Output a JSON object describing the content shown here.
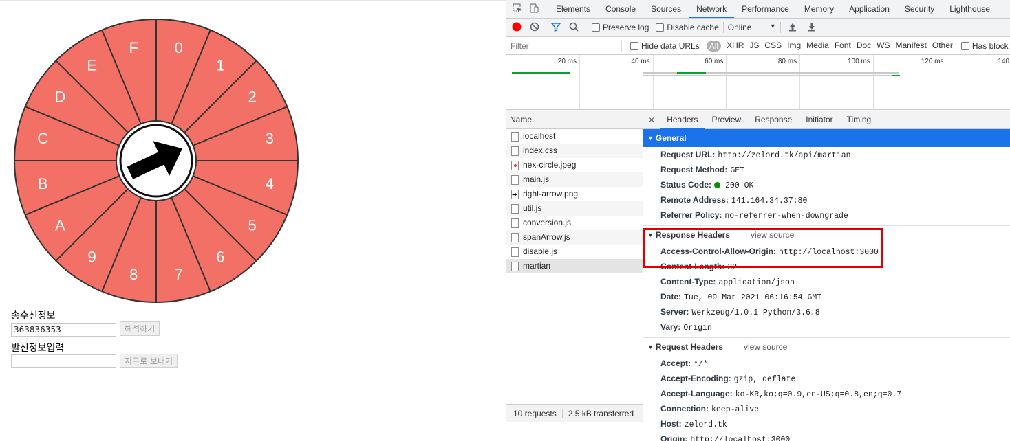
{
  "wheel": {
    "segments": [
      "0",
      "1",
      "2",
      "3",
      "4",
      "5",
      "6",
      "7",
      "8",
      "9",
      "A",
      "B",
      "C",
      "D",
      "E",
      "F"
    ],
    "fill_color": "#f27066",
    "arrow_direction": "3"
  },
  "form": {
    "received_label": "송수신정보",
    "received_value": "363836353",
    "decode_button": "해석하기",
    "send_label": "발신정보입력",
    "send_value": "",
    "send_button": "지구로 보내기"
  },
  "devtools": {
    "tabs": [
      "Elements",
      "Console",
      "Sources",
      "Network",
      "Performance",
      "Memory",
      "Application",
      "Security",
      "Lighthouse"
    ],
    "active_tab": "Network",
    "toolbar": {
      "preserve_log": "Preserve log",
      "disable_cache": "Disable cache",
      "throttle": "Online"
    },
    "filter": {
      "placeholder": "Filter",
      "hide_data_urls": "Hide data URLs",
      "types": [
        "All",
        "XHR",
        "JS",
        "CSS",
        "Img",
        "Media",
        "Font",
        "Doc",
        "WS",
        "Manifest",
        "Other"
      ],
      "has_blocked": "Has block"
    },
    "timeline": [
      "20 ms",
      "40 ms",
      "60 ms",
      "80 ms",
      "100 ms",
      "120 ms",
      "140 m"
    ],
    "name_header": "Name",
    "files": [
      "localhost",
      "index.css",
      "hex-circle.jpeg",
      "main.js",
      "right-arrow.png",
      "util.js",
      "conversion.js",
      "spanArrow.js",
      "disable.js",
      "martian"
    ],
    "selected_file": "martian",
    "status": {
      "requests": "10 requests",
      "transferred": "2.5 kB transferred"
    },
    "detail_tabs": [
      "Headers",
      "Preview",
      "Response",
      "Initiator",
      "Timing"
    ],
    "active_detail_tab": "Headers",
    "general": {
      "title": "General",
      "rows": [
        {
          "k": "Request URL:",
          "v": "http://zelord.tk/api/martian"
        },
        {
          "k": "Request Method:",
          "v": "GET"
        },
        {
          "k": "Status Code:",
          "v": "200 OK"
        },
        {
          "k": "Remote Address:",
          "v": "141.164.34.37:80"
        },
        {
          "k": "Referrer Policy:",
          "v": "no-referrer-when-downgrade"
        }
      ]
    },
    "response_headers": {
      "title": "Response Headers",
      "view_source": "view source",
      "rows": [
        {
          "k": "Access-Control-Allow-Origin:",
          "v": "http://localhost:3000"
        },
        {
          "k": "Content-Length:",
          "v": "32"
        },
        {
          "k": "Content-Type:",
          "v": "application/json"
        },
        {
          "k": "Date:",
          "v": "Tue, 09 Mar 2021 06:16:54 GMT"
        },
        {
          "k": "Server:",
          "v": "Werkzeug/1.0.1 Python/3.6.8"
        },
        {
          "k": "Vary:",
          "v": "Origin"
        }
      ]
    },
    "request_headers": {
      "title": "Request Headers",
      "view_source": "view source",
      "rows": [
        {
          "k": "Accept:",
          "v": "*/*"
        },
        {
          "k": "Accept-Encoding:",
          "v": "gzip, deflate"
        },
        {
          "k": "Accept-Language:",
          "v": "ko-KR,ko;q=0.9,en-US;q=0.8,en;q=0.7"
        },
        {
          "k": "Connection:",
          "v": "keep-alive"
        },
        {
          "k": "Host:",
          "v": "zelord.tk"
        },
        {
          "k": "Origin:",
          "v": "http://localhost:3000"
        }
      ]
    }
  }
}
